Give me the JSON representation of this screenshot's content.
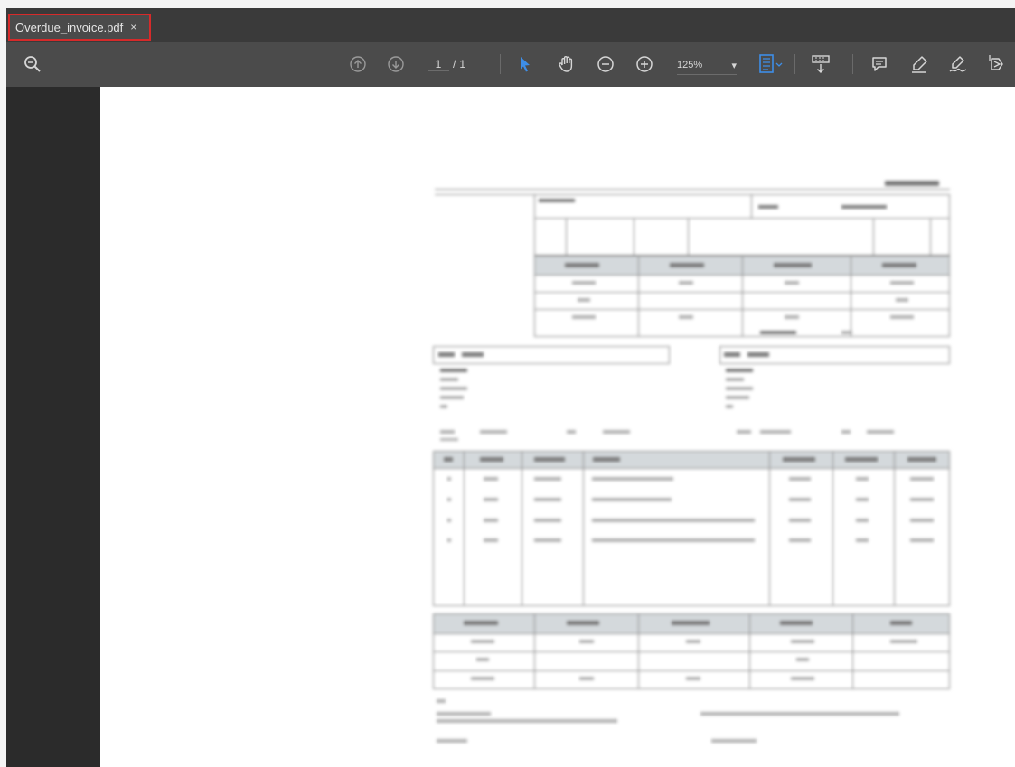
{
  "tab": {
    "title": "Overdue_invoice.pdf",
    "close_symbol": "×"
  },
  "toolbar": {
    "page_current": "1",
    "page_separator": "/",
    "page_total": "1",
    "zoom": "125%",
    "icons": [
      "zoom-search-icon",
      "page-up-icon",
      "page-down-icon",
      "select-arrow-icon",
      "hand-pan-icon",
      "zoom-out-icon",
      "zoom-in-icon",
      "fit-page-icon",
      "scroll-mode-icon",
      "comment-icon",
      "highlight-pen-icon",
      "sign-icon",
      "share-icon"
    ]
  },
  "colors": {
    "accent_blue": "#3d8ee8",
    "tab_border": "#d62a2a"
  }
}
